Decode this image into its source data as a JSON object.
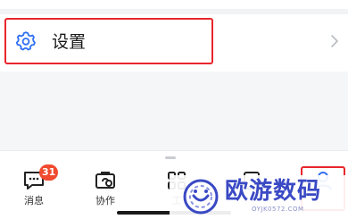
{
  "settings": {
    "label": "设置",
    "icon": "gear-icon",
    "chevron": "chevron-right-icon"
  },
  "tabbar": {
    "tabs": [
      {
        "label": "消息",
        "icon": "chat-icon",
        "badge": "31"
      },
      {
        "label": "协作",
        "icon": "collaboration-icon"
      },
      {
        "label": "工",
        "icon": "grid-icon"
      },
      {
        "label": "",
        "icon": "contacts-icon"
      },
      {
        "label": "",
        "icon": "profile-icon"
      }
    ]
  },
  "watermark": {
    "text": "欧游数码",
    "subtext": "OYJK0572.COM"
  },
  "colors": {
    "accent": "#2f6ff3",
    "highlight": "#e8262b",
    "badge": "#f04a2f",
    "watermark": "#3a49c4"
  }
}
